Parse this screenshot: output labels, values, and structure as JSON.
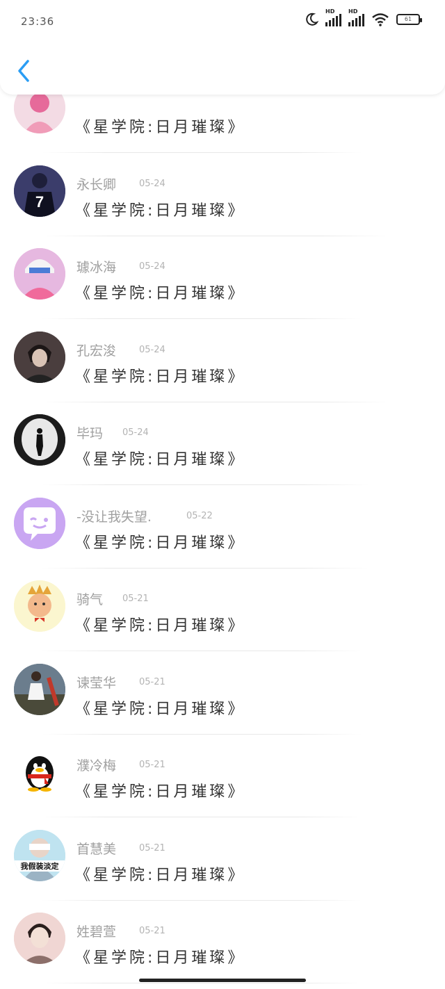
{
  "status_bar": {
    "time": "23:36",
    "battery_level": "61",
    "network_label": "HD"
  },
  "colors": {
    "accent": "#2a9df4",
    "name_text": "#a0a0a0",
    "title_text": "#333333"
  },
  "items": [
    {
      "name": "",
      "date": "",
      "title": "《星学院:日月璀璨》",
      "avatar": "pink-character-avatar",
      "bg": "#f3dbe4"
    },
    {
      "name": "永长卿",
      "date": "05-24",
      "title": "《星学院:日月璀璨》",
      "avatar": "jersey-7-avatar",
      "bg": "#3b3d6b"
    },
    {
      "name": "璩冰海",
      "date": "05-24",
      "title": "《星学院:日月璀璨》",
      "avatar": "pink-helmet-avatar",
      "bg": "#e6b8e0"
    },
    {
      "name": "孔宏浚",
      "date": "05-24",
      "title": "《星学院:日月璀璨》",
      "avatar": "anime-boy-avatar",
      "bg": "#4a3e3e"
    },
    {
      "name": "毕玛",
      "date": "05-24",
      "title": "《星学院:日月璀璨》",
      "avatar": "silhouette-avatar",
      "bg": "#1c1c1c"
    },
    {
      "name": "-没让我失望.",
      "date": "05-22",
      "title": "《星学院:日月璀璨》",
      "avatar": "chat-bubble-avatar",
      "bg": "#c9a6f2"
    },
    {
      "name": "骑气",
      "date": "05-21",
      "title": "《星学院:日月璀璨》",
      "avatar": "crown-boy-avatar",
      "bg": "#fbf6cf"
    },
    {
      "name": "谏莹华",
      "date": "05-21",
      "title": "《星学院:日月璀璨》",
      "avatar": "girl-photo-avatar",
      "bg": "#6b7d8d"
    },
    {
      "name": "濮冷梅",
      "date": "05-21",
      "title": "《星学院:日月璀璨》",
      "avatar": "qq-penguin-avatar",
      "bg": "#ffffff"
    },
    {
      "name": "首慧美",
      "date": "05-21",
      "title": "《星学院:日月璀璨》",
      "avatar": "masked-boy-avatar",
      "bg": "#bfe3f0",
      "caption": "我假装淡定"
    },
    {
      "name": "姓碧萱",
      "date": "05-21",
      "title": "《星学院:日月璀璨》",
      "avatar": "boy-portrait-avatar",
      "bg": "#f0d6d3"
    }
  ]
}
